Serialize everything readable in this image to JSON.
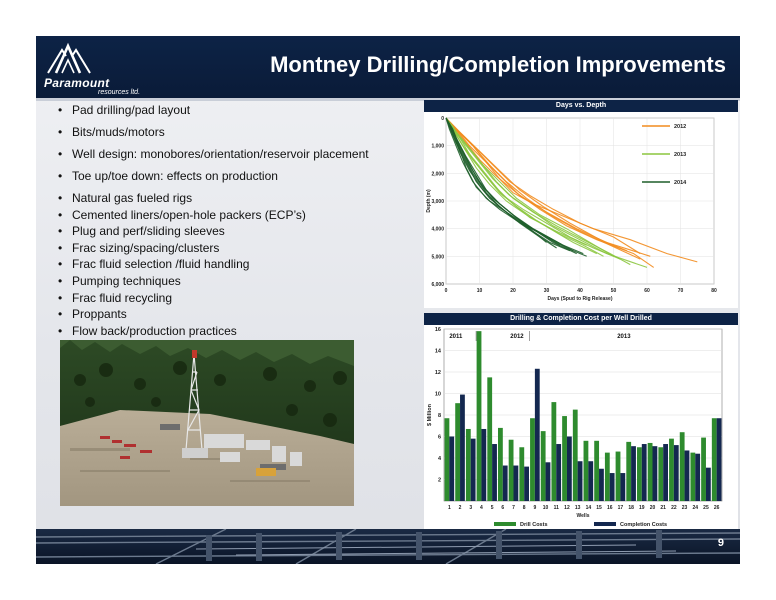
{
  "brand": {
    "name": "Paramount",
    "sub": "resources ltd."
  },
  "slide": {
    "title": "Montney Drilling/Completion Improvements",
    "page_number": "9"
  },
  "bullets": [
    "Pad drilling/pad layout",
    "Bits/muds/motors",
    "Well design: monobores/orientation/reservoir placement",
    "Toe up/toe down: effects on production",
    "Natural gas fueled rigs",
    "Cemented liners/open-hole packers (ECP’s)",
    "Plug and perf/sliding sleeves",
    "Frac sizing/spacing/clusters",
    "Frac fluid selection /fluid handling",
    "Pumping techniques",
    "Frac fluid recycling",
    "Proppants",
    "Flow back/production practices"
  ],
  "colors": {
    "y2012": "#f28c1e",
    "y2013": "#8cc63f",
    "y2014": "#1e5e2a",
    "drill": "#2e8b2e",
    "completion": "#142850"
  },
  "chart_data": [
    {
      "type": "line",
      "title": "Days vs. Depth",
      "xlabel": "Days (Spud to Rig Release)",
      "ylabel": "Depth (m)",
      "xlim": [
        0,
        80
      ],
      "ylim": [
        0,
        6000
      ],
      "y_inverted": true,
      "x_ticks": [
        "0",
        "10",
        "20",
        "30",
        "40",
        "50",
        "60",
        "70",
        "80"
      ],
      "y_ticks": [
        "0",
        "1,000",
        "2,000",
        "3,000",
        "4,000",
        "5,000",
        "6,000"
      ],
      "legend_position": "right",
      "series": [
        {
          "name": "2012",
          "color_key": "y2012",
          "wells": [
            {
              "days": [
                0,
                3,
                8,
                12,
                16,
                20,
                26,
                34,
                44,
                55,
                66,
                75
              ],
              "depth": [
                0,
                400,
                1000,
                1600,
                2200,
                2700,
                3100,
                3500,
                4000,
                4400,
                4900,
                5200
              ]
            },
            {
              "days": [
                0,
                4,
                9,
                14,
                19,
                25,
                32,
                40,
                50,
                58
              ],
              "depth": [
                0,
                500,
                1100,
                1700,
                2300,
                2800,
                3300,
                3800,
                4300,
                4900
              ]
            },
            {
              "days": [
                0,
                3,
                7,
                12,
                17,
                22,
                30,
                39,
                48,
                61
              ],
              "depth": [
                0,
                400,
                1000,
                1600,
                2200,
                2800,
                3400,
                4000,
                4500,
                5000
              ]
            },
            {
              "days": [
                0,
                2,
                6,
                10,
                15,
                21,
                28,
                36,
                45,
                56,
                62
              ],
              "depth": [
                0,
                300,
                900,
                1500,
                2100,
                2700,
                3300,
                3900,
                4400,
                4900,
                5400
              ]
            },
            {
              "days": [
                0,
                3,
                8,
                13,
                18,
                24,
                31,
                40,
                49,
                58
              ],
              "depth": [
                0,
                400,
                1000,
                1700,
                2300,
                2900,
                3500,
                4100,
                4600,
                5100
              ]
            },
            {
              "days": [
                0,
                4,
                10,
                16,
                22,
                29,
                37,
                46,
                54
              ],
              "depth": [
                0,
                500,
                1200,
                1900,
                2600,
                3200,
                3800,
                4400,
                4800
              ]
            }
          ]
        },
        {
          "name": "2013",
          "color_key": "y2013",
          "wells": [
            {
              "days": [
                0,
                3,
                7,
                11,
                15,
                20,
                26,
                33,
                41,
                49,
                55
              ],
              "depth": [
                0,
                500,
                1100,
                1700,
                2300,
                2900,
                3400,
                3900,
                4400,
                4900,
                5300
              ]
            },
            {
              "days": [
                0,
                2,
                6,
                10,
                14,
                19,
                25,
                32,
                40,
                48,
                60
              ],
              "depth": [
                0,
                400,
                1000,
                1600,
                2200,
                2800,
                3300,
                3900,
                4400,
                4900,
                5400
              ]
            },
            {
              "days": [
                0,
                3,
                6,
                9,
                13,
                18,
                24,
                31,
                38,
                45
              ],
              "depth": [
                0,
                600,
                1200,
                1800,
                2400,
                3000,
                3500,
                4000,
                4500,
                4900
              ]
            },
            {
              "days": [
                0,
                2,
                5,
                9,
                13,
                17,
                23,
                30,
                37,
                44,
                52
              ],
              "depth": [
                0,
                400,
                1000,
                1600,
                2200,
                2800,
                3300,
                3800,
                4300,
                4700,
                5100
              ]
            },
            {
              "days": [
                0,
                3,
                7,
                11,
                16,
                21,
                28,
                36,
                43,
                50
              ],
              "depth": [
                0,
                500,
                1100,
                1700,
                2300,
                2900,
                3500,
                4000,
                4500,
                5000
              ]
            },
            {
              "days": [
                0,
                2,
                5,
                8,
                12,
                16,
                21,
                27,
                34,
                41,
                47
              ],
              "depth": [
                0,
                300,
                900,
                1500,
                2100,
                2700,
                3200,
                3700,
                4200,
                4600,
                5000
              ]
            },
            {
              "days": [
                0,
                3,
                6,
                10,
                14,
                19,
                25,
                33,
                42
              ],
              "depth": [
                0,
                600,
                1200,
                1800,
                2400,
                3000,
                3600,
                4100,
                4600
              ]
            }
          ]
        },
        {
          "name": "2014",
          "color_key": "y2014",
          "wells": [
            {
              "days": [
                0,
                2,
                5,
                8,
                11,
                15,
                20,
                26,
                32,
                38
              ],
              "depth": [
                0,
                500,
                1200,
                1900,
                2500,
                3000,
                3500,
                4000,
                4400,
                4800
              ]
            },
            {
              "days": [
                0,
                2,
                4,
                7,
                10,
                14,
                19,
                24,
                30,
                36,
                42
              ],
              "depth": [
                0,
                400,
                1000,
                1700,
                2300,
                2900,
                3400,
                3900,
                4300,
                4700,
                5000
              ]
            },
            {
              "days": [
                0,
                3,
                6,
                9,
                12,
                16,
                21,
                27,
                34
              ],
              "depth": [
                0,
                700,
                1400,
                2000,
                2600,
                3100,
                3600,
                4100,
                4600
              ]
            },
            {
              "days": [
                0,
                2,
                4,
                6,
                9,
                13,
                18,
                23,
                29,
                35,
                41
              ],
              "depth": [
                0,
                400,
                1100,
                1800,
                2500,
                3000,
                3400,
                3800,
                4200,
                4600,
                4900
              ]
            },
            {
              "days": [
                0,
                1,
                3,
                6,
                9,
                13,
                17,
                22,
                28,
                33
              ],
              "depth": [
                0,
                300,
                900,
                1600,
                2300,
                2900,
                3300,
                3800,
                4300,
                4700
              ]
            },
            {
              "days": [
                0,
                2,
                5,
                8,
                12,
                16,
                21,
                26,
                31,
                37
              ],
              "depth": [
                0,
                600,
                1300,
                2000,
                2700,
                3200,
                3700,
                4100,
                4500,
                4800
              ]
            },
            {
              "days": [
                0,
                2,
                4,
                7,
                11,
                15,
                20,
                25,
                30
              ],
              "depth": [
                0,
                500,
                1200,
                1900,
                2600,
                3100,
                3600,
                4000,
                4500
              ]
            },
            {
              "days": [
                0,
                1,
                3,
                5,
                8,
                12,
                16,
                21,
                27,
                32,
                39
              ],
              "depth": [
                0,
                400,
                1000,
                1600,
                2300,
                2900,
                3300,
                3700,
                4100,
                4500,
                4900
              ]
            }
          ]
        }
      ]
    },
    {
      "type": "bar",
      "title": "Drilling & Completion Cost per Well Drilled",
      "xlabel": "Wells",
      "ylabel": "$ Million",
      "ylim": [
        0,
        16
      ],
      "y_ticks": [
        "2",
        "4",
        "6",
        "8",
        "10",
        "12",
        "14",
        "16"
      ],
      "legend_position": "bottom",
      "period_labels": [
        "2011",
        "2012",
        "2013"
      ],
      "categories": [
        "1",
        "2",
        "3",
        "4",
        "5",
        "6",
        "7",
        "8",
        "9",
        "10",
        "11",
        "12",
        "13",
        "14",
        "15",
        "16",
        "17",
        "18",
        "19",
        "20",
        "21",
        "22",
        "23",
        "24",
        "25",
        "26"
      ],
      "series": [
        {
          "name": "Drill Costs",
          "color_key": "drill",
          "values": [
            7.7,
            9.1,
            6.7,
            15.8,
            11.5,
            6.8,
            5.7,
            5.0,
            7.7,
            6.5,
            9.2,
            7.9,
            8.5,
            5.6,
            5.6,
            4.5,
            4.6,
            5.5,
            5.0,
            5.4,
            5.0,
            5.8,
            6.4,
            4.5,
            5.9,
            7.7
          ]
        },
        {
          "name": "Completion Costs",
          "color_key": "completion",
          "values": [
            6.0,
            9.9,
            5.8,
            6.7,
            5.3,
            3.3,
            3.3,
            3.2,
            12.3,
            3.6,
            5.3,
            6.0,
            3.7,
            3.7,
            3.0,
            2.6,
            2.6,
            5.1,
            5.3,
            5.1,
            5.3,
            5.2,
            4.7,
            4.4,
            3.1,
            7.7
          ]
        }
      ]
    }
  ]
}
